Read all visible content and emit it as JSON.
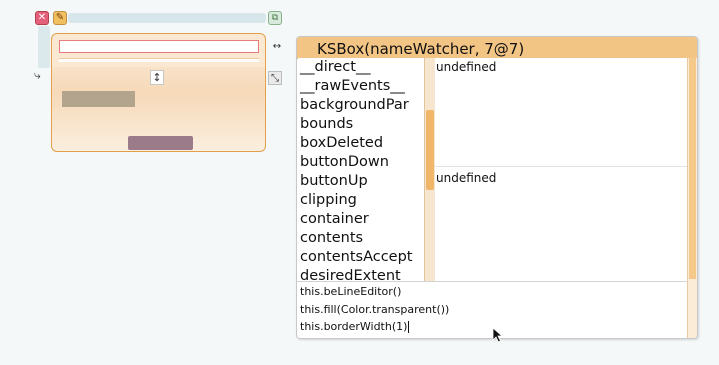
{
  "inspector": {
    "title": "KSBox(nameWatcher, 7@7)",
    "slots": [
      "__direct__",
      "__rawEvents__",
      "backgroundPar",
      "bounds",
      "boxDeleted",
      "buttonDown",
      "buttonUp",
      "clipping",
      "container",
      "contents",
      "contentsAccept",
      "desiredExtent"
    ],
    "value_top": "undefined",
    "value_mid": "undefined",
    "code_lines": [
      "this.beLineEditor()",
      "this.fill(Color.transparent())",
      "this.borderWidth(1)"
    ]
  },
  "halo": {
    "close_icon": "close-icon",
    "menu_icon": "menu-icon",
    "collapse_icon": "collapse-icon",
    "resize_icons": [
      "resize-vertical-icon",
      "resize-horizontal-icon",
      "resize-corner-icon"
    ]
  },
  "colors": {
    "accent": "#f3c585",
    "halo_close": "#e4607a",
    "field_border": "#e87b7b",
    "swatch_a": "#b3a48e",
    "swatch_b": "#9b7a8a"
  }
}
